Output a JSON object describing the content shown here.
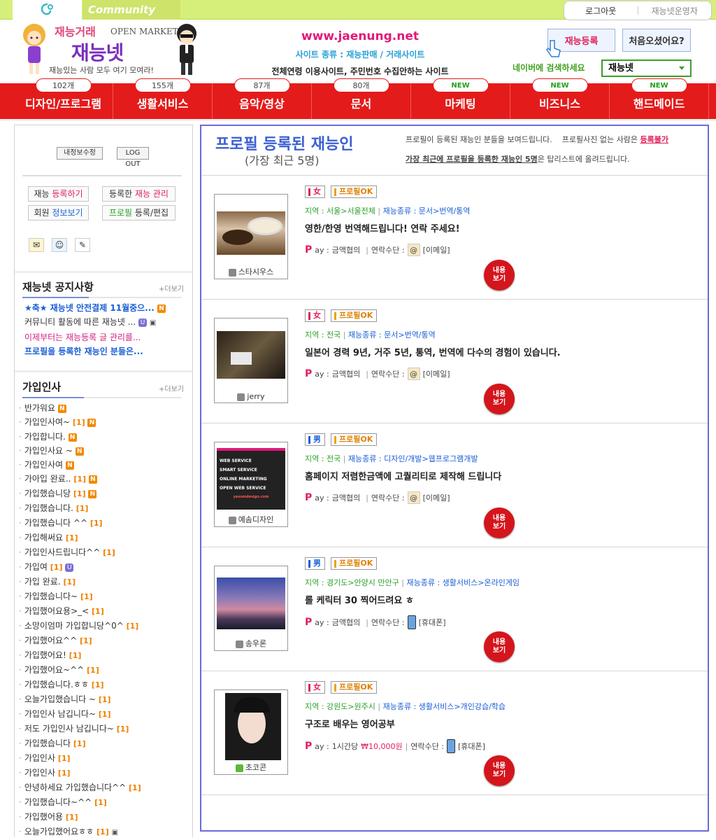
{
  "top": {
    "tab_community": "Community",
    "logout": "로그아웃",
    "operator": "재능넷운영자"
  },
  "logo": {
    "sub": "재능거래",
    "open_market": "OPEN MARKET",
    "title": "재능넷",
    "slogan": "재능있는 사람 모두 여기 모여라!"
  },
  "site": {
    "url": "www.jaenung.net",
    "type": "사이트 종류 : 재능판매 / 거래사이트",
    "note": "전체연령 이용사이트, 주민번호 수집안하는 사이트"
  },
  "header_buttons": {
    "register": "재능등록",
    "first_visit": "처음오셨어요?"
  },
  "naver": {
    "label": "네이버에 검색하세요",
    "value": "재능넷"
  },
  "nav": [
    {
      "count": "102개",
      "label": "디자인/프로그램"
    },
    {
      "count": "155개",
      "label": "생활서비스"
    },
    {
      "count": "87개",
      "label": "음악/영상"
    },
    {
      "count": "80개",
      "label": "문서"
    },
    {
      "count": "NEW",
      "label": "마케팅"
    },
    {
      "count": "NEW",
      "label": "비즈니스"
    },
    {
      "count": "NEW",
      "label": "핸드메이드"
    }
  ],
  "sidebar": {
    "btn_mypoint": "내정보수정",
    "btn_logout": "LOG OUT",
    "menu": [
      {
        "a": "재능 ",
        "b": "등록하기"
      },
      {
        "a": "등록한 ",
        "b": "재능 관리"
      },
      {
        "a": "회원 ",
        "b": "정보보기"
      },
      {
        "a": "프로필 ",
        "b": "등록/편집"
      }
    ],
    "notice_title": "재능넷 공지사항",
    "gi_title": "가입인사",
    "more": "+더보기",
    "notices": [
      "★축★ 재능넷 안전결제 11월중으...",
      "커뮤니티 활동에 따른 재능넷 ...",
      "이제부터는 재능등록 글 관리를...",
      "프로필을 등록한 재능인 분들은..."
    ],
    "greetings": [
      {
        "t": "반가워요",
        "c": "",
        "n": true
      },
      {
        "t": "가입인사여~",
        "c": "[1]",
        "n": true
      },
      {
        "t": "가입합니다.",
        "c": "",
        "n": true
      },
      {
        "t": "가입인사요 ~",
        "c": "",
        "n": true
      },
      {
        "t": "가입인사여",
        "c": "",
        "n": true
      },
      {
        "t": "가아입 완료..",
        "c": "[1]",
        "n": true
      },
      {
        "t": "가입했습니당",
        "c": "[1]",
        "n": true
      },
      {
        "t": "가입했습니다.",
        "c": "[1]",
        "n": false
      },
      {
        "t": "가입했습니다 ^^",
        "c": "[1]",
        "n": false
      },
      {
        "t": "가입해써요",
        "c": "[1]",
        "n": false
      },
      {
        "t": "가입인사드립니다^^",
        "c": "[1]",
        "n": false
      },
      {
        "t": "가입여",
        "c": "[1]",
        "n": false
      },
      {
        "t": "가입 완료.",
        "c": "[1]",
        "n": false
      },
      {
        "t": "가입했습니다~",
        "c": "[1]",
        "n": false
      },
      {
        "t": "가입했어요용>_<",
        "c": "[1]",
        "n": false
      },
      {
        "t": "소망이엄마 가입합니당^0^",
        "c": "[1]",
        "n": false
      },
      {
        "t": "가입했어요^^",
        "c": "[1]",
        "n": false
      },
      {
        "t": "가입했어요!",
        "c": "[1]",
        "n": false
      },
      {
        "t": "가입했어요~^^",
        "c": "[1]",
        "n": false
      },
      {
        "t": "가입했습니다.ㅎㅎ",
        "c": "[1]",
        "n": false
      },
      {
        "t": "오늘가입했습니다 ~",
        "c": "[1]",
        "n": false
      },
      {
        "t": "가입인사 남깁니다~",
        "c": "[1]",
        "n": false
      },
      {
        "t": "저도 가입인사 남깁니다~",
        "c": "[1]",
        "n": false
      },
      {
        "t": "가입했습니다",
        "c": "[1]",
        "n": false
      },
      {
        "t": "가입인사",
        "c": "[1]",
        "n": false
      },
      {
        "t": "가입인사",
        "c": "[1]",
        "n": false
      },
      {
        "t": "안녕하세요 가입했습니다^^",
        "c": "[1]",
        "n": false
      },
      {
        "t": "가입했습니다~^^",
        "c": "[1]",
        "n": false
      },
      {
        "t": "가입했어용",
        "c": "[1]",
        "n": false
      },
      {
        "t": "오늘가입했어요ㅎㅎ",
        "c": "[1]",
        "n": false
      }
    ]
  },
  "main": {
    "title": "프로필 등록된 재능인",
    "subtitle": "(가장 최근 5명)",
    "desc1_a": "프로필이 등록된 재능인 분들을 보여드립니다.",
    "desc1_b": "프로필사진 없는 사람은 ",
    "desc1_c": "등록불가",
    "desc2_a": "가장 최근에 프로필을 등록한 재능인 5명",
    "desc2_b": "은 탑리스트에 올려드립니다.",
    "profile_ok": "프로필OK",
    "pay_label": "ay : ",
    "contact_label": "연락수단 : ",
    "more_btn": "내용 보기",
    "region_label": "지역 : ",
    "type_label": "재능종류 : "
  },
  "cards": [
    {
      "name": "스타시우스",
      "gender": "女",
      "region": "서울>서울전체",
      "type": "문서>번역/통역",
      "title": "영한/한영 번역해드립니다! 연락 주세요!",
      "pay": "금액협의",
      "money": "",
      "contact": "[이메일]"
    },
    {
      "name": "jerry",
      "gender": "女",
      "region": "전국",
      "type": "문서>번역/통역",
      "title": "일본어 경력 9년, 거주 5년, 통역, 번역에 다수의 경험이 있습니다.",
      "pay": "금액협의",
      "money": "",
      "contact": "[이메일]"
    },
    {
      "name": "예솜디자인",
      "gender": "男",
      "region": "전국",
      "type": "디자인/개발>웹프로그램개발",
      "title": "홈페이지 저렴한금액에 고퀄리티로 제작해 드립니다",
      "pay": "금액협의",
      "money": "",
      "contact": "[이메일]"
    },
    {
      "name": "송우론",
      "gender": "男",
      "region": "경기도>안양시 만안구",
      "type": "생활서비스>온라인게임",
      "title": "롤 케릭터 30 찍어드려요 ㅎ",
      "pay": "금액협의",
      "money": "",
      "contact": "[휴대폰]"
    },
    {
      "name": "초코콘",
      "gender": "女",
      "region": "강원도>원주시",
      "type": "생활서비스>개인강습/학습",
      "title": "구조로 배우는 영어공부",
      "pay": "1시간당 ",
      "money": "₩10,000원",
      "contact": "[휴대폰]"
    }
  ],
  "web_ad": [
    "WEB SERVICE",
    "SMART SERVICE",
    "ONLINE MARKETING",
    "OPEN WEB SERVICE",
    "yesomdesign.com"
  ],
  "colors": {
    "nav_red": "#e41b1b",
    "accent_pink": "#e0205a",
    "main_border": "#6a6adc",
    "top_green": "#d6ef7a"
  }
}
